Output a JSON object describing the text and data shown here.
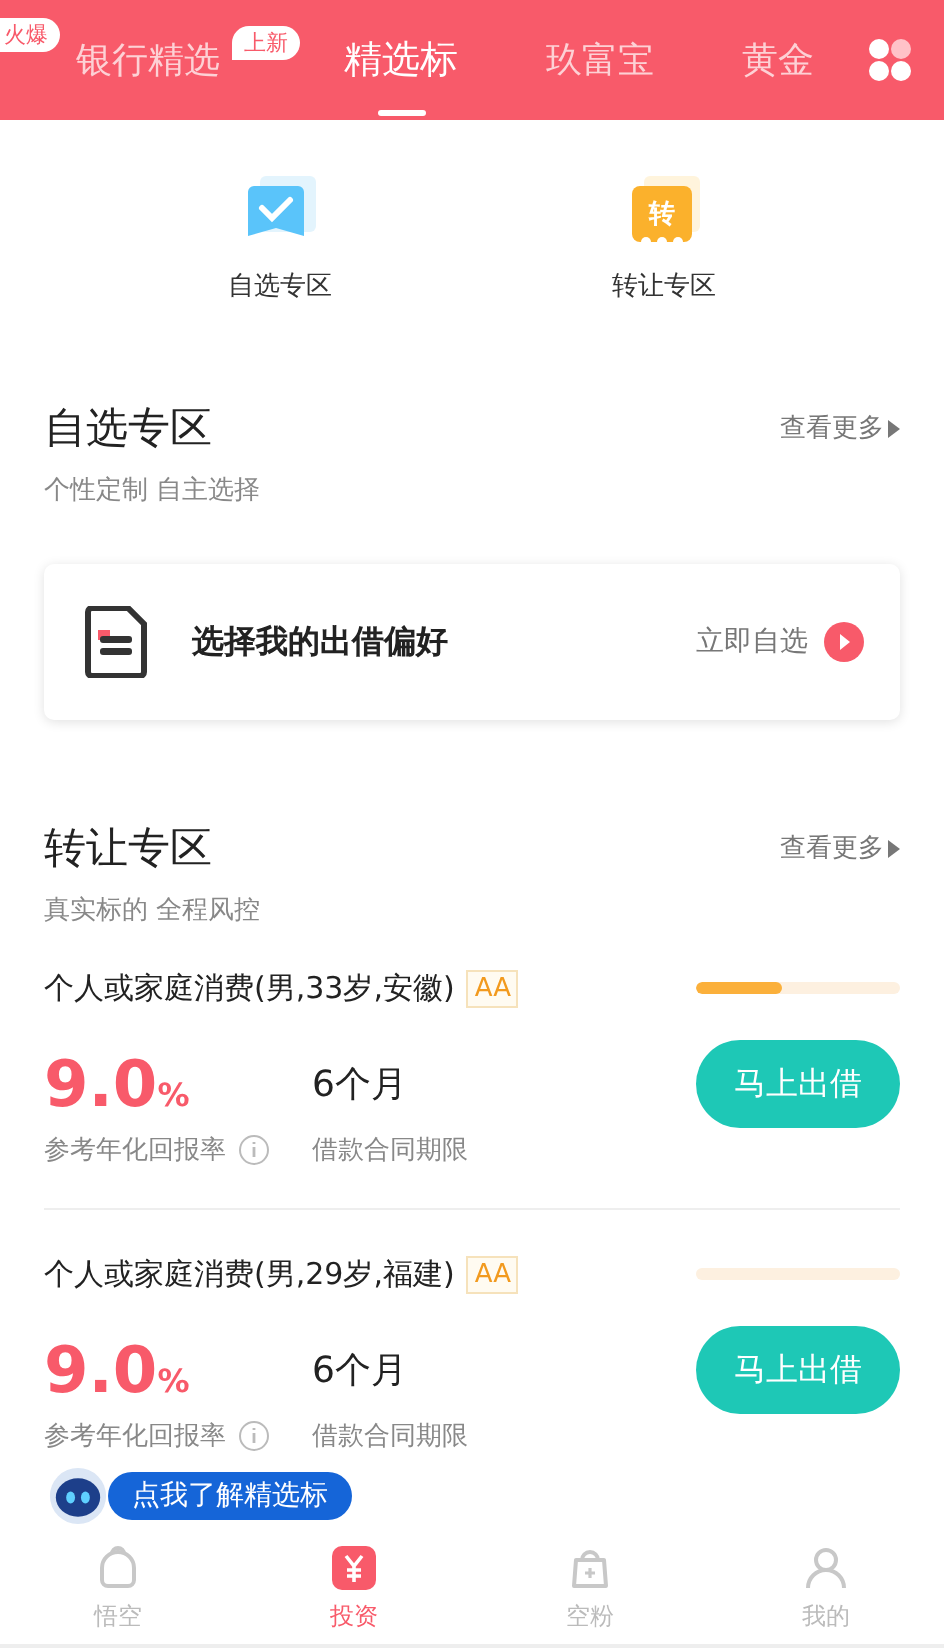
{
  "hot_badge": "火爆",
  "tabs": [
    {
      "label": "银行精选",
      "badge": "上新",
      "selected": false
    },
    {
      "label": "精选标",
      "selected": true
    },
    {
      "label": "玖富宝",
      "selected": false
    },
    {
      "label": "黄金",
      "selected": false
    }
  ],
  "quick_entries": [
    {
      "kind": "check",
      "label": "自选专区"
    },
    {
      "kind": "transfer",
      "icon_text": "转",
      "label": "转让专区"
    }
  ],
  "sections": [
    {
      "title": "自选专区",
      "more": "查看更多",
      "subtitle": "个性定制 自主选择",
      "card": {
        "text": "选择我的出借偏好",
        "action": "立即自选"
      }
    },
    {
      "title": "转让专区",
      "more": "查看更多",
      "subtitle": "真实标的 全程风控",
      "loans": [
        {
          "title": "个人或家庭消费(男,33岁,安徽)",
          "rating": "AA",
          "level": 0.42,
          "rate": "9.0",
          "rate_unit": "%",
          "rate_label": "参考年化回报率",
          "term": "6个月",
          "term_label": "借款合同期限",
          "button": "马上出借"
        },
        {
          "title": "个人或家庭消费(男,29岁,福建)",
          "rating": "AA",
          "level": 0,
          "rate": "9.0",
          "rate_unit": "%",
          "rate_label": "参考年化回报率",
          "term": "6个月",
          "term_label": "借款合同期限",
          "button": "马上出借"
        }
      ]
    }
  ],
  "assistant_tip": "点我了解精选标",
  "bottom_nav": [
    {
      "kind": "cloud",
      "label": "悟空",
      "selected": false
    },
    {
      "kind": "yen",
      "label": "投资",
      "selected": true
    },
    {
      "kind": "bag",
      "label": "空粉",
      "selected": false
    },
    {
      "kind": "person",
      "label": "我的",
      "selected": false
    }
  ]
}
